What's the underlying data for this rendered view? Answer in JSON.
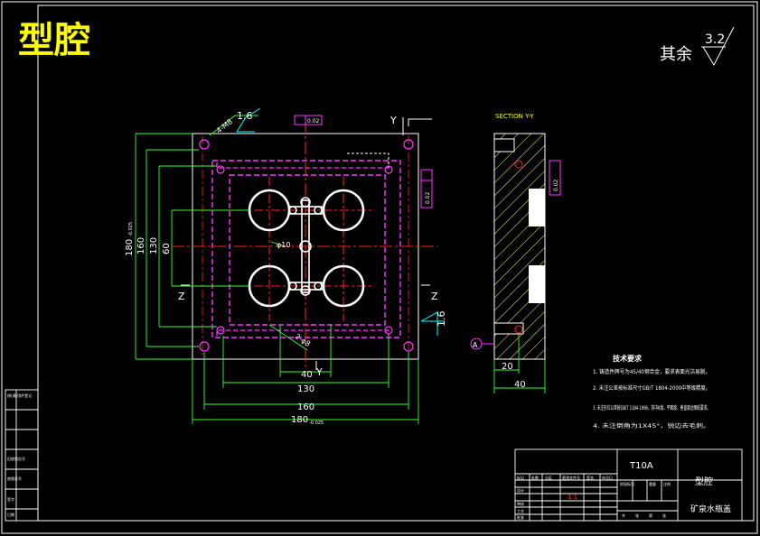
{
  "title": "型腔",
  "roughness": {
    "label": "其余",
    "value": "3.2"
  },
  "section_label": "SECTION Y-Y",
  "colors": {
    "frame": "#ffffff",
    "outline": "#ffffff",
    "centerline": "#ff2020",
    "hidden": "#ff33ff",
    "dimension": "#33ff33",
    "hatch": "#ffff66",
    "annotation": "#00ffff",
    "title_yellow": "#ffff00",
    "notes": "#ffffff"
  },
  "plan": {
    "dims": {
      "w40": "40",
      "w130": "130",
      "w160": "160",
      "w180": "180",
      "w180_tol": "-0.025",
      "h60": "60",
      "h130": "130",
      "h160": "160",
      "h180": "180",
      "h180_tol": "-0.025",
      "phi10": "φ10",
      "holes_tl": "4-M8",
      "holes_br": "2-φ8"
    },
    "roughness_top": "1.6",
    "roughness_right": "1.6",
    "gdt_top": "0.02",
    "gdt_right": "0.02",
    "axis_y": "Y",
    "axis_y_bottom": "Y",
    "axis_z_left": "Z",
    "axis_z_right": "Z"
  },
  "section": {
    "dim_20": "20",
    "dim_40": "40",
    "datum": "A",
    "gdt": "0.02"
  },
  "notes": {
    "heading": "技术要求",
    "items": [
      "1. 铸造件牌号为45/40钢合金，要求表面光洁易脱。",
      "2. 未注公差按标准尺寸GB/T 1804-2000中等级精度。",
      "3. 未注形位公差按GB/T 1184-1996，其中K级。平面度、垂直度达图纸要求。",
      "4. 未注倒角为1X45°，锐边去毛刺。"
    ]
  },
  "title_block": {
    "material": "T10A",
    "part_name": "型腔",
    "drawing_title": "矿泉水瓶盖",
    "scale": "1:1",
    "row_labels": [
      "标记",
      "处数",
      "分区",
      "更改文件号",
      "签名",
      "年月日"
    ],
    "role_labels": [
      "设计",
      "审核",
      "工艺",
      "批准"
    ],
    "stage_labels": [
      "阶段标记",
      "重量",
      "比例"
    ],
    "sheet_labels": [
      "共",
      "张",
      "第",
      "张"
    ]
  },
  "side_block": {
    "labels": [
      "借(通)用件登记",
      "旧底图总号",
      "底图总号",
      "签字",
      "日期"
    ]
  }
}
